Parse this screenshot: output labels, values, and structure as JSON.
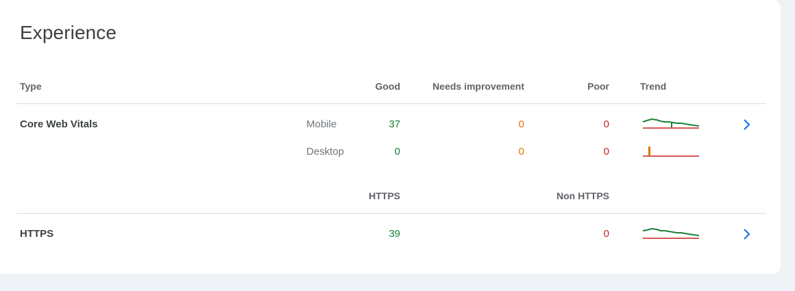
{
  "title": "Experience",
  "cwv_header": {
    "type": "Type",
    "good": "Good",
    "needs": "Needs improvement",
    "poor": "Poor",
    "trend": "Trend"
  },
  "cwv": {
    "label": "Core Web Vitals",
    "rows": [
      {
        "device": "Mobile",
        "good": "37",
        "needs": "0",
        "poor": "0"
      },
      {
        "device": "Desktop",
        "good": "0",
        "needs": "0",
        "poor": "0"
      }
    ]
  },
  "https_header": {
    "https": "HTTPS",
    "non_https": "Non HTTPS"
  },
  "https": {
    "label": "HTTPS",
    "https": "39",
    "non_https": "0"
  },
  "colors": {
    "good": "#188038",
    "needs": "#e37400",
    "poor": "#c5221f",
    "accent": "#1a73e8"
  },
  "icons": {
    "row_open": "chevron-right-icon"
  }
}
